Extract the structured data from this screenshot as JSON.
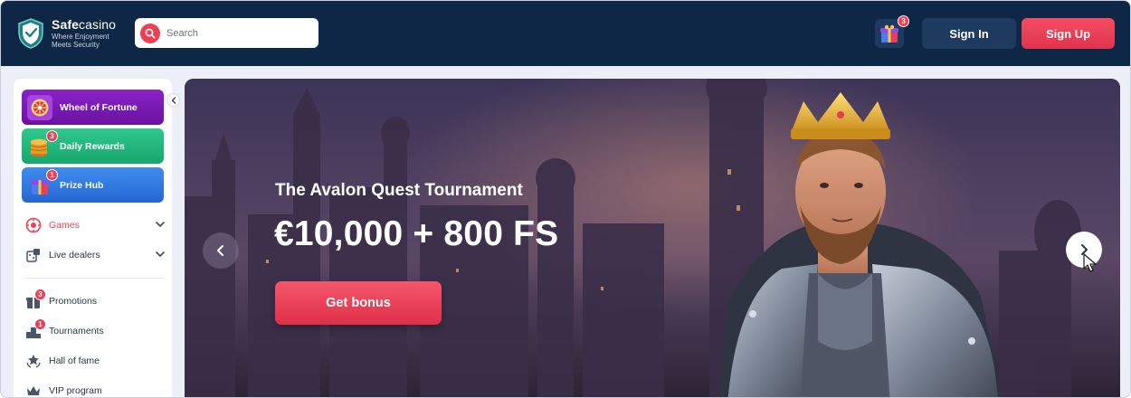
{
  "brand": {
    "name_bold": "Safe",
    "name_thin": "casino",
    "tagline": "Where Enjoyment Meets Security"
  },
  "header": {
    "search_placeholder": "Search",
    "gift_badge": "3",
    "sign_in": "Sign In",
    "sign_up": "Sign Up"
  },
  "sidebar": {
    "promos": [
      {
        "label": "Wheel of Fortune",
        "icon": "wheel-icon"
      },
      {
        "label": "Daily Rewards",
        "icon": "coins-icon",
        "badge": "3"
      },
      {
        "label": "Prize Hub",
        "icon": "gift-icon",
        "badge": "1"
      }
    ],
    "nav": [
      {
        "label": "Games",
        "icon": "games-icon",
        "active": true
      },
      {
        "label": "Live dealers",
        "icon": "live-dealers-icon"
      },
      {
        "label": "Promotions",
        "icon": "promotions-icon",
        "badge": "3"
      },
      {
        "label": "Tournaments",
        "icon": "tournaments-icon",
        "badge": "1"
      },
      {
        "label": "Hall of fame",
        "icon": "hall-of-fame-icon"
      },
      {
        "label": "VIP program",
        "icon": "crown-icon"
      }
    ]
  },
  "banner": {
    "subtitle": "The Avalon Quest Tournament",
    "title": "€10,000 + 800 FS",
    "cta": "Get bonus"
  },
  "colors": {
    "header_bg": "#0f2746",
    "accent": "#ee3f55",
    "page_bg": "#eceef8"
  }
}
